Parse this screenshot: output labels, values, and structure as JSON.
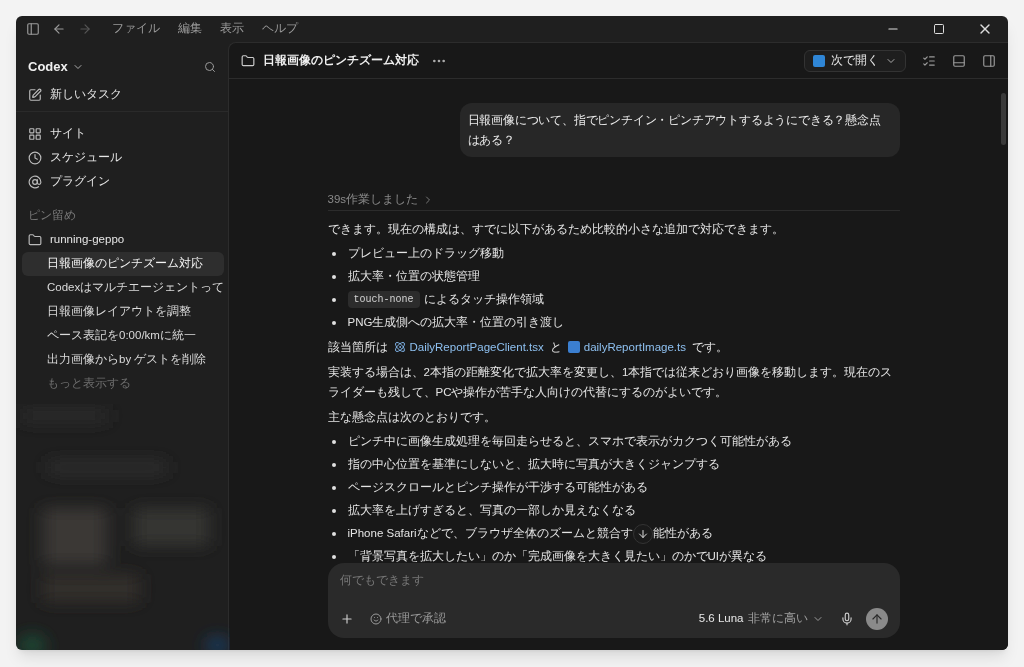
{
  "menu": [
    "ファイル",
    "編集",
    "表示",
    "ヘルプ"
  ],
  "sidebar": {
    "app_name": "Codex",
    "new_task": "新しいタスク",
    "nav": [
      {
        "kind": "site",
        "label": "サイト"
      },
      {
        "kind": "schedule",
        "label": "スケジュール"
      },
      {
        "kind": "plugin",
        "label": "プラグイン"
      }
    ],
    "pinned_heading": "ピン留め",
    "project": "running-geppo",
    "threads": [
      {
        "label": "日報画像のピンチズーム対応",
        "selected": true
      },
      {
        "label": "Codexはマルチエージェントって",
        "selected": false
      },
      {
        "label": "日報画像レイアウトを調整",
        "selected": false
      },
      {
        "label": "ペース表記を0:00/kmに統一",
        "selected": false
      },
      {
        "label": "出力画像からby ゲストを削除",
        "selected": false
      }
    ],
    "show_more": "もっと表示する"
  },
  "thread": {
    "title": "日報画像のピンチズーム対応",
    "open_with": "次で開く"
  },
  "user_message": "日報画像について、指でピンチイン・ピンチアウトするようにできる？懸念点はある？",
  "worked_for": "39s作業しました",
  "response": [
    {
      "kind": "paragraph",
      "text": "できます。現在の構成は、すでに以下があるため比較的小さな追加で対応できます。"
    },
    {
      "kind": "bullets",
      "items": [
        {
          "text": "プレビュー上のドラッグ移動"
        },
        {
          "text": "拡大率・位置の状態管理"
        },
        {
          "code": "touch-none",
          "text": "によるタッチ操作領域"
        },
        {
          "text": "PNG生成側への拡大率・位置の引き渡し"
        }
      ]
    },
    {
      "kind": "files",
      "parts": [
        {
          "kind": "text",
          "text": "該当箇所は"
        },
        {
          "kind": "react_file",
          "text": "DailyReportPageClient.tsx"
        },
        {
          "kind": "text",
          "text": "と"
        },
        {
          "kind": "ts_file",
          "text": "dailyReportImage.ts"
        },
        {
          "kind": "text",
          "text": "です。"
        }
      ]
    },
    {
      "kind": "paragraph",
      "text": "実装する場合は、2本指の距離変化で拡大率を変更し、1本指では従来どおり画像を移動します。現在のスライダーも残して、PCや操作が苦手な人向けの代替にするのがよいです。"
    },
    {
      "kind": "paragraph",
      "text": "主な懸念点は次のとおりです。"
    },
    {
      "kind": "bullets",
      "items": [
        {
          "text": "ピンチ中に画像生成処理を毎回走らせると、スマホで表示がカクつく可能性がある"
        },
        {
          "text": "指の中心位置を基準にしないと、拡大時に写真が大きくジャンプする"
        },
        {
          "text": "ページスクロールとピンチ操作が干渉する可能性がある"
        },
        {
          "text": "拡大率を上げすぎると、写真の一部しか見えなくなる"
        },
        {
          "text": "iPhone Safariなどで、ブラウザ全体のズームと競合す",
          "text_after": "能性がある"
        },
        {
          "text": "「背景写真を拡大したい」のか「完成画像を大きく見たい」のかでUIが異なる"
        }
      ]
    }
  ],
  "composer": {
    "placeholder": "何でもできます",
    "approval": "代理で承認",
    "model": "5.6 Luna",
    "effort": "非常に高い"
  }
}
